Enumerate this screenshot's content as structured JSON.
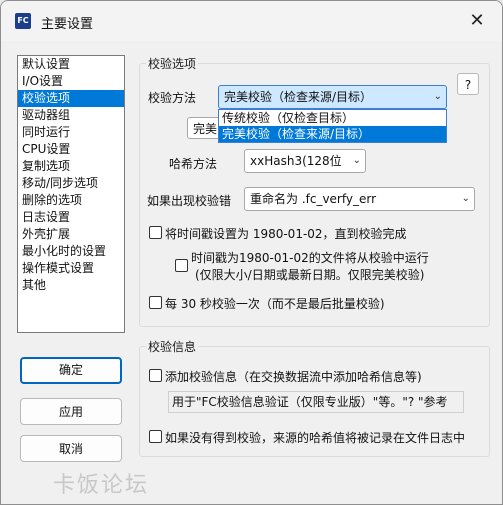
{
  "window": {
    "title": "主要设置",
    "icon_text": "FC",
    "close_glyph": "✕"
  },
  "sidebar": {
    "items": [
      {
        "label": "默认设置"
      },
      {
        "label": "I/O设置"
      },
      {
        "label": "校验选项",
        "selected": true
      },
      {
        "label": "驱动器组"
      },
      {
        "label": "同时运行"
      },
      {
        "label": "CPU设置"
      },
      {
        "label": "复制选项"
      },
      {
        "label": "移动/同步选项"
      },
      {
        "label": "删除的选项"
      },
      {
        "label": "日志设置"
      },
      {
        "label": "外壳扩展"
      },
      {
        "label": "最小化时的设置"
      },
      {
        "label": "操作模式设置"
      },
      {
        "label": "其他"
      }
    ]
  },
  "buttons": {
    "ok": "确定",
    "apply": "应用",
    "cancel": "取消",
    "help": "?"
  },
  "verify_options": {
    "legend": "校验选项",
    "method_label": "校验方法",
    "method_value": "完美校验（检查来源/目标）",
    "method_options": [
      "传统校验（仅检查目标）",
      "完美校验（检查来源/目标）"
    ],
    "hidden_partial": "完美",
    "hash_label": "哈希方法",
    "hash_value": "xxHash3(128位",
    "error_label": "如果出现校验错",
    "error_value": "重命名为 .fc_verfy_err",
    "timestamp_check": {
      "label": "将时间戳设置为 1980-01-02，直到校验完成",
      "checked": false
    },
    "timestamp_sub": {
      "line1": "时间戳为1980-01-02的文件将从校验中运行",
      "line2": "(仅限大小/日期或最新日期。仅限完美校验)",
      "checked": false
    },
    "periodic_check": {
      "label": "每 30 秒校验一次（而不是最后批量校验)",
      "checked": false
    }
  },
  "verify_info": {
    "legend": "校验信息",
    "add_info": {
      "label": "添加校验信息（在交换数据流中添加哈希信息等)",
      "checked": false
    },
    "readonly_text": "用于\"FC校验信息验证（仅限专业版）\"等。\"? \"参考",
    "log_check": {
      "label": "如果没有得到校验，来源的哈希值将被记录在文件日志中",
      "checked": false
    }
  },
  "watermark": "卡饭论坛"
}
